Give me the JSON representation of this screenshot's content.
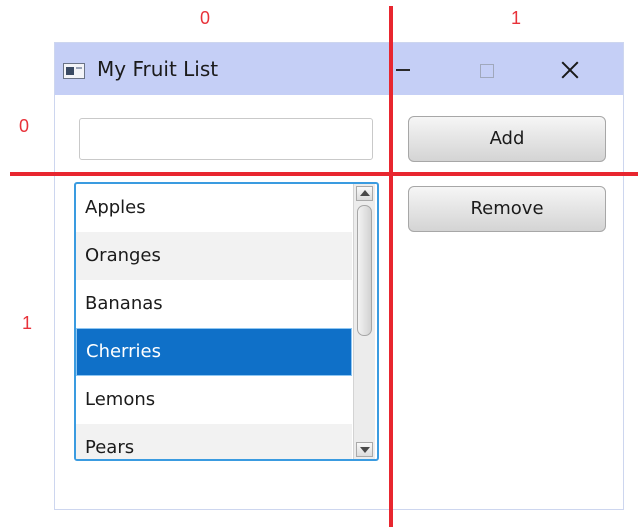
{
  "grid_indices": {
    "column_0": "0",
    "column_1": "1",
    "row_0": "0",
    "row_1": "1",
    "color": "#e8323a"
  },
  "window": {
    "title": "My Fruit List",
    "app_icon": "window-app-icon",
    "controls": [
      "minimize-icon",
      "maximize-icon",
      "close-icon"
    ]
  },
  "form": {
    "input_value": "",
    "add_label": "Add",
    "remove_label": "Remove"
  },
  "fruit_list": {
    "items": [
      "Apples",
      "Oranges",
      "Bananas",
      "Cherries",
      "Lemons",
      "Pears"
    ],
    "selected": "Cherries",
    "selected_color": "#0f70c8",
    "focus_color": "#3a9be0"
  }
}
